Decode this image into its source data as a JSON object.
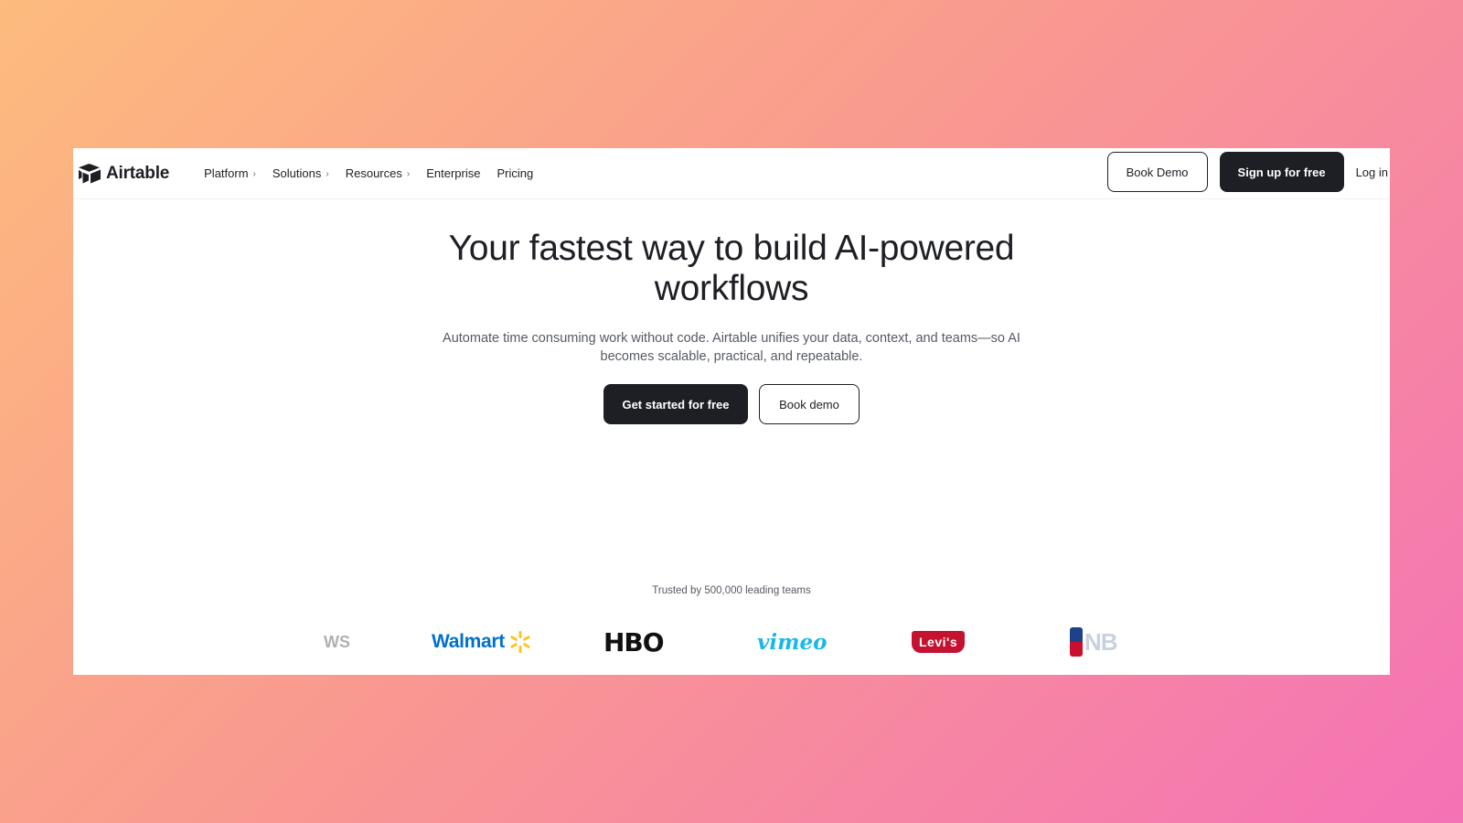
{
  "brand": {
    "name": "Airtable",
    "logo_icon": "airtable-logo-icon"
  },
  "nav": {
    "items": [
      {
        "label": "Platform",
        "has_submenu": true
      },
      {
        "label": "Solutions",
        "has_submenu": true
      },
      {
        "label": "Resources",
        "has_submenu": true
      },
      {
        "label": "Enterprise",
        "has_submenu": false
      },
      {
        "label": "Pricing",
        "has_submenu": false
      }
    ],
    "book_demo": "Book Demo",
    "signup": "Sign up for free",
    "login": "Log in"
  },
  "hero": {
    "title_line1": "Your fastest way to build AI-powered",
    "title_line2": "workflows",
    "subtitle_line1": "Automate time consuming work without code. Airtable unifies your data, context, and teams—so AI",
    "subtitle_line2": "becomes scalable, practical, and repeatable.",
    "cta_primary": "Get started for free",
    "cta_secondary": "Book demo"
  },
  "trusted": {
    "text": "Trusted by 500,000 leading teams",
    "logos": [
      "WS",
      "Walmart",
      "HBO",
      "vimeo",
      "Levi's",
      "NB"
    ]
  },
  "colors": {
    "ink": "#1d1f25",
    "muted": "#555a63",
    "walmart_blue": "#0071ce",
    "walmart_spark": "#ffc220",
    "vimeo_blue": "#1ab7ea",
    "levis_red": "#c41230"
  }
}
